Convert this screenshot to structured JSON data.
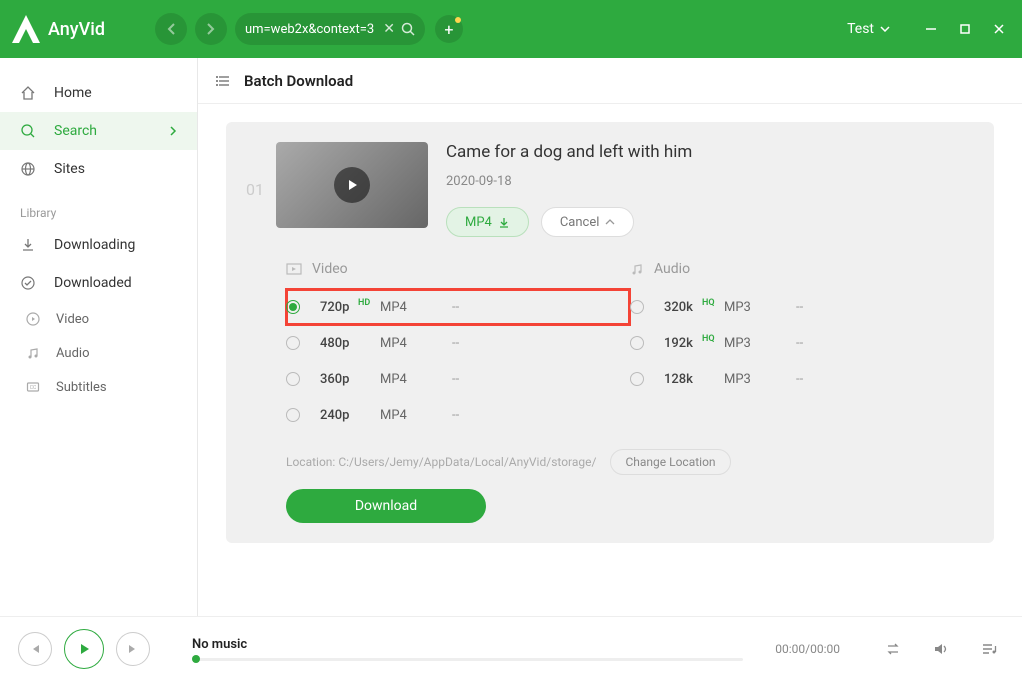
{
  "app": {
    "name": "AnyVid"
  },
  "urlbar": {
    "text": "um=web2x&context=3"
  },
  "header": {
    "test_label": "Test"
  },
  "sidebar": {
    "items": [
      {
        "label": "Home"
      },
      {
        "label": "Search"
      },
      {
        "label": "Sites"
      }
    ],
    "library_header": "Library",
    "library": [
      {
        "label": "Downloading"
      },
      {
        "label": "Downloaded"
      }
    ],
    "subs": [
      {
        "label": "Video"
      },
      {
        "label": "Audio"
      },
      {
        "label": "Subtitles"
      }
    ]
  },
  "page": {
    "title": "Batch Download"
  },
  "card": {
    "number": "01",
    "title": "Came for a dog and left with him",
    "date": "2020-09-18",
    "mp4_label": "MP4",
    "cancel_label": "Cancel"
  },
  "options": {
    "video_header": "Video",
    "audio_header": "Audio",
    "video": [
      {
        "res": "720p",
        "badge": "HD",
        "fmt": "MP4",
        "size": "--",
        "selected": true,
        "highlight": true
      },
      {
        "res": "480p",
        "fmt": "MP4",
        "size": "--"
      },
      {
        "res": "360p",
        "fmt": "MP4",
        "size": "--"
      },
      {
        "res": "240p",
        "fmt": "MP4",
        "size": "--"
      }
    ],
    "audio": [
      {
        "res": "320k",
        "badge": "HQ",
        "fmt": "MP3",
        "size": "--"
      },
      {
        "res": "192k",
        "badge": "HQ",
        "fmt": "MP3",
        "size": "--"
      },
      {
        "res": "128k",
        "fmt": "MP3",
        "size": "--"
      }
    ],
    "location_prefix": "Location:",
    "location_path": "C:/Users/Jemy/AppData/Local/AnyVid/storage/",
    "change_location": "Change Location",
    "download_label": "Download"
  },
  "player": {
    "title": "No music",
    "time": "00:00/00:00"
  }
}
